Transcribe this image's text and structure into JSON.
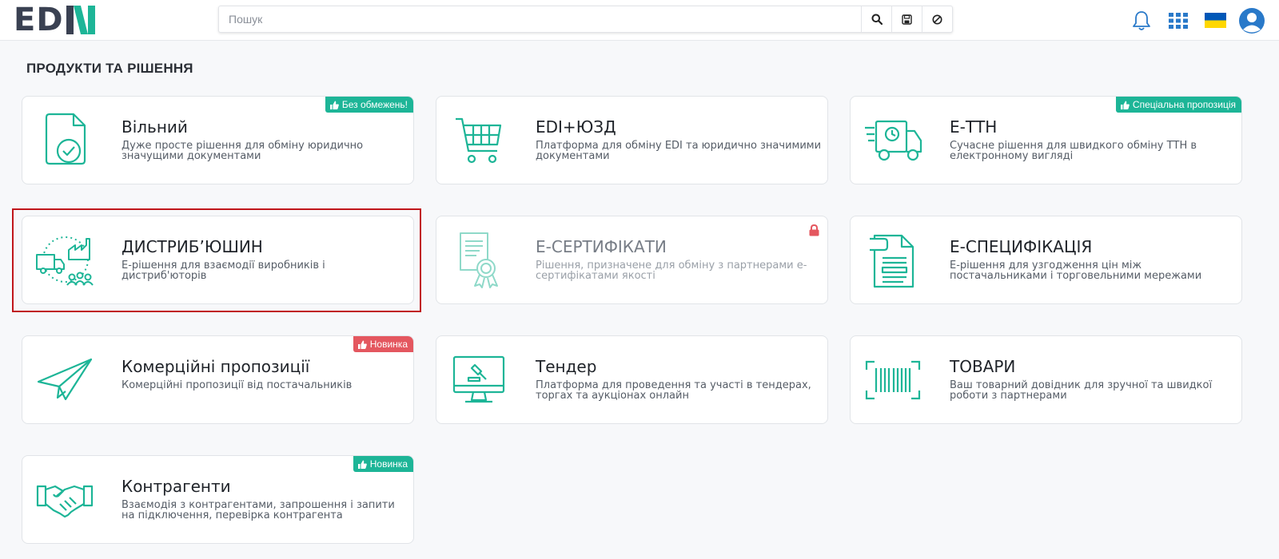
{
  "logo": {
    "text_left": "ED",
    "text_right": "N"
  },
  "search": {
    "placeholder": "Пошук",
    "value": ""
  },
  "page": {
    "title": "ПРОДУКТИ ТА РІШЕННЯ"
  },
  "colors": {
    "accent": "#1db597",
    "badge_red": "#e4575f",
    "highlight": "#c0161b",
    "flag_blue": "#0057b7",
    "flag_yellow": "#ffd700"
  },
  "cards": [
    {
      "title": "Вільний",
      "desc": "Дуже просте рішення для обміну юридично значущими документами",
      "badge": "Без обмежень!",
      "icon": "document-check-icon"
    },
    {
      "title": "EDI+ЮЗД",
      "desc": "Платформа для обміну EDI та юридично значимими документами",
      "icon": "shopping-cart-icon"
    },
    {
      "title": "Е-ТТН",
      "desc": "Сучасне рішення для швидкого обміну ТТН в електронному вигляді",
      "badge": "Спеціальна пропозиція",
      "icon": "delivery-truck-icon"
    },
    {
      "title": "ДИСТРИБ’ЮШИН",
      "desc": "Е-рішення для взаємодії виробників і дистриб'юторів",
      "icon": "distribution-icon"
    },
    {
      "title": "Е-СЕРТИФІКАТИ",
      "desc": "Рішення, призначене для обміну з партнерами е-сертифікатами якості",
      "icon": "certificate-icon",
      "locked": true
    },
    {
      "title": "Е-СПЕЦИФІКАЦІЯ",
      "desc": "Е-рішення для узгодження цін між постачальниками і торговельними мережами",
      "icon": "specification-icon"
    },
    {
      "title": "Комерційні пропозиції",
      "desc": "Комерційні пропозиції від постачальників",
      "badge": "Новинка",
      "icon": "paper-plane-icon"
    },
    {
      "title": "Тендер",
      "desc": "Платформа для проведення та участі в тендерах, торгах та аукціонах онлайн",
      "icon": "tender-monitor-icon"
    },
    {
      "title": "ТОВАРИ",
      "desc": "Ваш товарний довідник для зручної та швидкої роботи з партнерами",
      "icon": "barcode-icon"
    },
    {
      "title": "Контрагенти",
      "desc": "Взаємодія з контрагентами, запрошення і запити на підключення, перевірка контрагента",
      "badge": "Новинка",
      "icon": "handshake-icon"
    }
  ]
}
